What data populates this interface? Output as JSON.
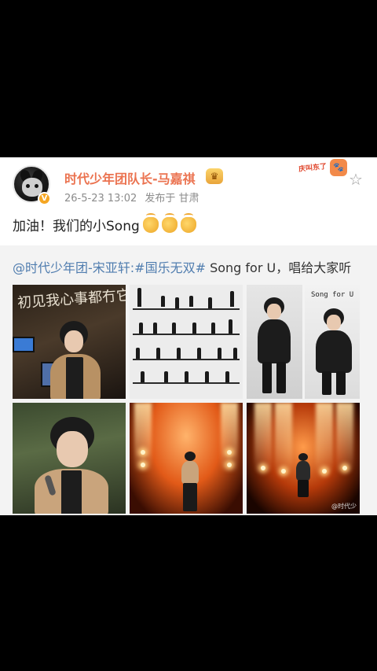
{
  "post": {
    "username": "时代少年团队长-马嘉祺",
    "crown_icon": "crown-badge-icon",
    "verified_icon": "verified-v-icon",
    "timestamp": "26-5-23 13:02",
    "location": "发布于 甘肃",
    "sticker_text": "庆叫东了",
    "favorite_icon": "star-outline-icon",
    "content_text": "加油！我们的小Song",
    "emoji": [
      "clapping-hands-icon",
      "clapping-hands-icon",
      "clapping-hands-icon"
    ]
  },
  "repost": {
    "mention": "@时代少年团-宋亚轩",
    "topic": ":#国乐无双#",
    "text": " Song for U，唱给大家听",
    "images": [
      {
        "name": "photo-1",
        "caption": "初见我心事都冇它"
      },
      {
        "name": "photo-2",
        "caption": ""
      },
      {
        "name": "photo-3",
        "caption": ""
      },
      {
        "name": "photo-4",
        "caption": "Song for U"
      },
      {
        "name": "photo-5",
        "caption": ""
      },
      {
        "name": "photo-6",
        "caption": ""
      },
      {
        "name": "photo-7",
        "caption": "@时代少"
      }
    ]
  },
  "colors": {
    "username": "#eb7350",
    "link": "#507daf",
    "meta": "#8b8b8b",
    "verified": "#f5a623"
  }
}
